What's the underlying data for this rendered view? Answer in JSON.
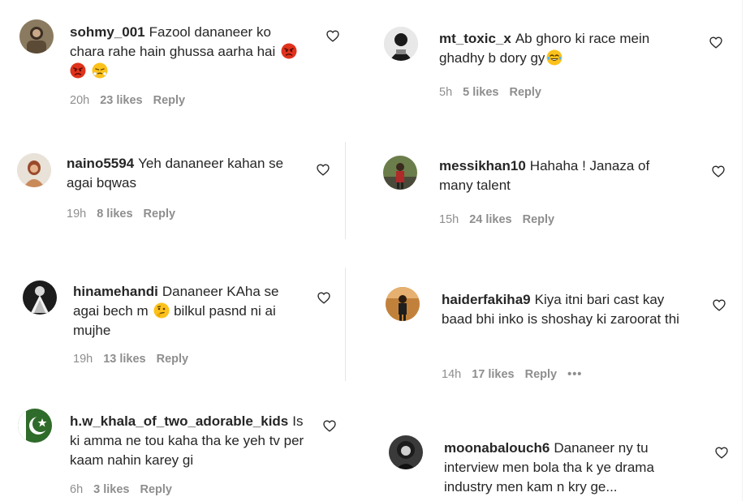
{
  "comments": [
    {
      "username": "sohmy_001",
      "text": "Fazool dananeer ko chara rahe hain ghussa aarha hai",
      "emojis": [
        "angry-face",
        "steam-face"
      ],
      "time": "20h",
      "likes": "23 likes",
      "reply": "Reply"
    },
    {
      "username": "naino5594",
      "text": "Yeh dananeer kahan se agai bqwas",
      "time": "19h",
      "likes": "8 likes",
      "reply": "Reply"
    },
    {
      "username": "hinamehandi",
      "text_before": "Dananeer KAha se agai bech m",
      "text_after": "bilkul pasnd ni ai mujhe",
      "emojis": [
        "thinking-face"
      ],
      "time": "19h",
      "likes": "13 likes",
      "reply": "Reply"
    },
    {
      "username": "h.w_khala_of_two_adorable_kids",
      "text": "Is ki amma ne tou kaha tha ke yeh tv per kaam nahin karey gi",
      "time": "6h",
      "likes": "3 likes",
      "reply": "Reply"
    },
    {
      "username": "mt_toxic_x",
      "text": "Ab ghoro ki race mein ghadhy b dory gy",
      "emojis": [
        "tears-of-joy-face"
      ],
      "time": "5h",
      "likes": "5 likes",
      "reply": "Reply"
    },
    {
      "username": "messikhan10",
      "text": "Hahaha ! Janaza of many talent",
      "time": "15h",
      "likes": "24 likes",
      "reply": "Reply"
    },
    {
      "username": "haiderfakiha9",
      "text": "Kiya itni bari cast kay baad bhi inko is shoshay ki zaroorat thi",
      "time": "14h",
      "likes": "17 likes",
      "reply": "Reply",
      "more": "•••"
    },
    {
      "username": "moonabalouch6",
      "text": "Dananeer ny tu interview men bola tha k ye drama industry men kam n kry ge..."
    }
  ]
}
